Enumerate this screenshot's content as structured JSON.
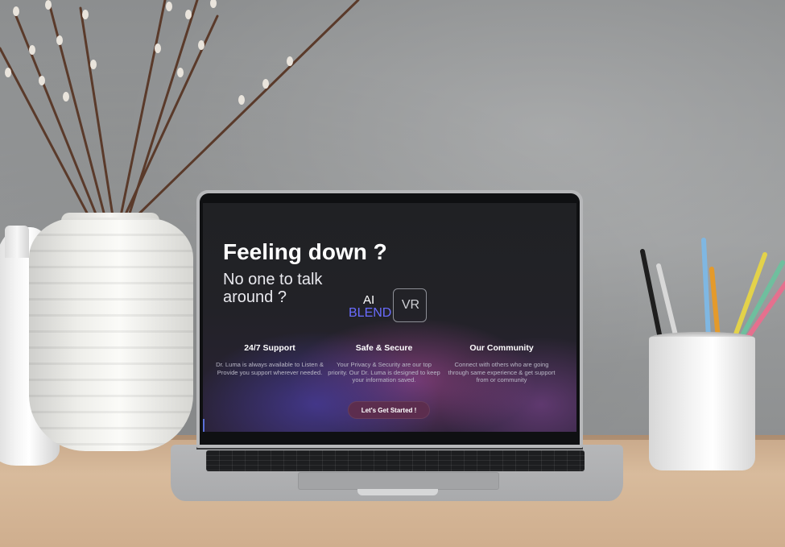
{
  "screen": {
    "headline": "Feeling down ?",
    "subline": "No one to talk around ?",
    "logo": {
      "ai": "AI",
      "blend": "BLEND",
      "vr": "VR"
    },
    "features": [
      {
        "title": "24/7 Support",
        "text": "Dr. Luma is always available to Listen & Provide you support wherever needed."
      },
      {
        "title": "Safe & Secure",
        "text": "Your Privacy & Security are our top priority. Our Dr. Luma is designed to keep your information saved."
      },
      {
        "title": "Our Community",
        "text": "Connect with others who are going through same experience & get support from or community"
      }
    ],
    "cta_label": "Let's Get Started !"
  },
  "colors": {
    "screen_bg": "#202124",
    "brand_blue": "#6a6cff",
    "cta_bg": "#5c2d4e",
    "glow_purple": "#be50aa"
  }
}
